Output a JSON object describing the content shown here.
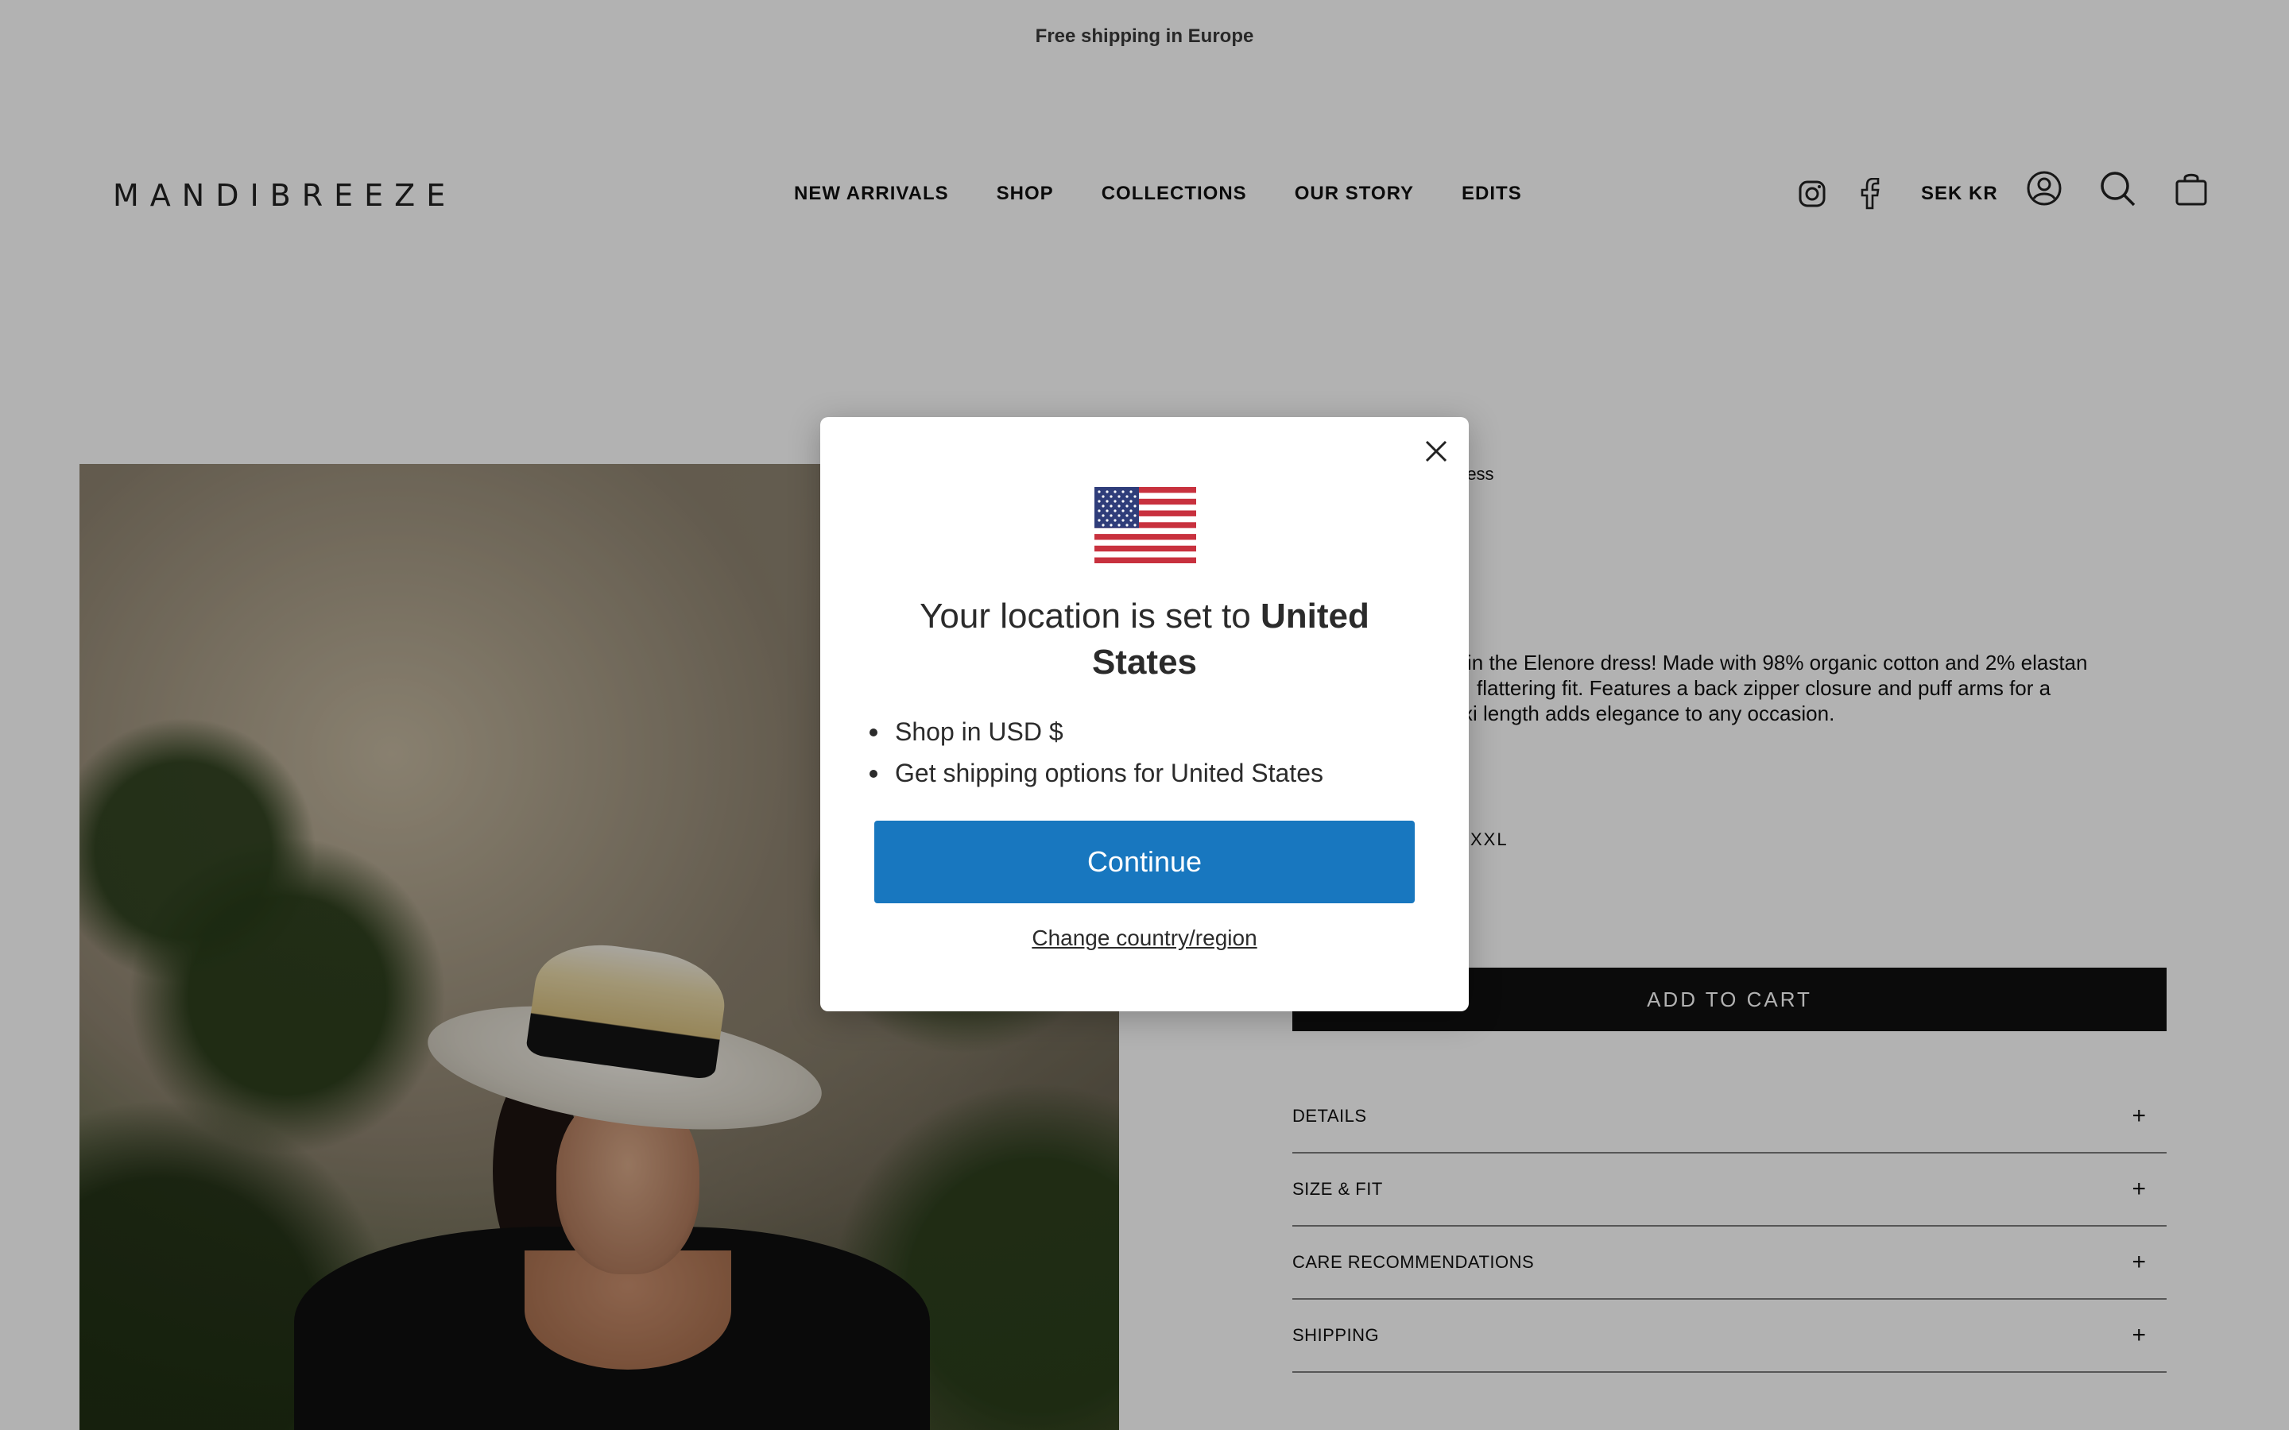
{
  "announcement": "Free shipping in Europe",
  "header": {
    "logo": "MANDIBREEZE",
    "nav": [
      "NEW ARRIVALS",
      "SHOP",
      "COLLECTIONS",
      "OUR STORY",
      "EDITS"
    ],
    "currency": "SEK KR",
    "icons": [
      "instagram-icon",
      "facebook-icon",
      "account-icon",
      "search-icon",
      "cart-bag-icon"
    ]
  },
  "product": {
    "breadcrumb_visible": "ress",
    "description_visible": [
      "in the Elenore dress! Made with 98% organic cotton and 2% elastan",
      "flattering fit. Features a back zipper closure and puff arms for a",
      "xi length adds elegance to any occasion."
    ],
    "size_visible": "XXL",
    "add_to_cart": "ADD TO CART",
    "accordion": [
      "DETAILS",
      "SIZE & FIT",
      "CARE RECOMMENDATIONS",
      "SHIPPING"
    ],
    "accordion_icon": "+"
  },
  "modal": {
    "title_prefix": "Your location is set to ",
    "title_country": "United States",
    "bullets": [
      "Shop in USD $",
      "Get shipping options for United States"
    ],
    "continue": "Continue",
    "change": "Change country/region",
    "flag_icon": "us-flag-icon"
  },
  "colors": {
    "overlay": "rgba(0,0,0,0.30)",
    "continue_button": "#1877bf",
    "add_to_cart_button": "#111111"
  }
}
